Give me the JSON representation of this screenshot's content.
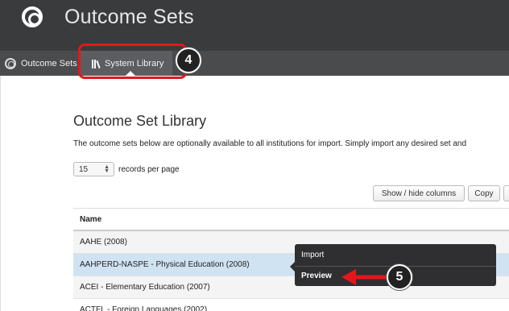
{
  "header": {
    "title": "Outcome Sets",
    "icon": "target-icon"
  },
  "subnav": {
    "items": [
      {
        "label": "Outcome Sets",
        "icon": "target-icon"
      },
      {
        "label": "System Library",
        "icon": "library-books-icon"
      }
    ]
  },
  "annotations": {
    "step4": "4",
    "step5": "5",
    "highlight_color": "#e3171b"
  },
  "page": {
    "title": "Outcome Set Library",
    "description": "The outcome sets below are optionally available to all institutions for import. Simply import any desired set and"
  },
  "records": {
    "value": "15",
    "label": "records per page"
  },
  "toolbar": {
    "show_hide_columns": "Show / hide columns",
    "copy": "Copy"
  },
  "table": {
    "header": "Name",
    "rows": [
      "AAHE (2008)",
      "AAHPERD-NASPE - Physical Education (2008)",
      "ACEI - Elementary Education (2007)",
      "ACTFL - Foreign Languages (2002)"
    ]
  },
  "context_menu": {
    "import": "Import",
    "preview": "Preview"
  }
}
